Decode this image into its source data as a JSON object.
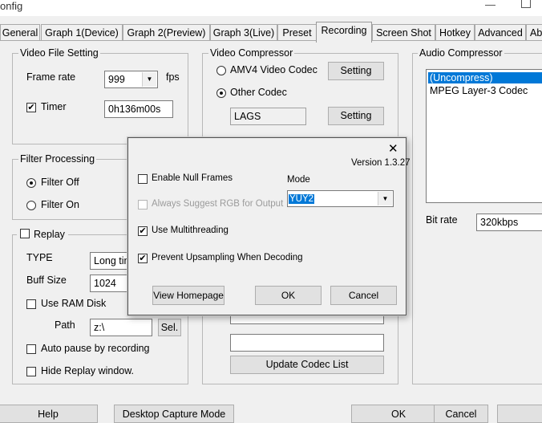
{
  "window": {
    "title": "onfig"
  },
  "tabs": [
    {
      "label": "General"
    },
    {
      "label": "Graph 1(Device)"
    },
    {
      "label": "Graph 2(Preview)"
    },
    {
      "label": "Graph 3(Live)"
    },
    {
      "label": "Preset"
    },
    {
      "label": "Recording"
    },
    {
      "label": "Screen Shot"
    },
    {
      "label": "Hotkey"
    },
    {
      "label": "Advanced"
    },
    {
      "label": "Ab"
    }
  ],
  "video_file": {
    "legend": "Video File Setting",
    "frame_rate_label": "Frame rate",
    "frame_rate_value": "999",
    "fps_label": "fps",
    "timer_label": "Timer",
    "timer_checked": true,
    "timer_value": "0h136m00s"
  },
  "filter": {
    "legend": "Filter Processing",
    "off_label": "Filter Off",
    "on_label": "Filter On",
    "selected": "off"
  },
  "replay": {
    "legend": "Replay",
    "checked": false,
    "type_label": "TYPE",
    "type_value": "Long tim",
    "buff_label": "Buff Size",
    "buff_value": "1024",
    "ram_label": "Use RAM Disk",
    "path_label": "Path",
    "path_value": "z:\\",
    "sel_label": "Sel.",
    "auto_pause_label": "Auto pause by recording",
    "hide_label": "Hide Replay window."
  },
  "video_compressor": {
    "legend": "Video Compressor",
    "amv4_label": "AMV4 Video Codec",
    "other_label": "Other Codec",
    "setting_label": "Setting",
    "codec_value": "LAGS",
    "update_label": "Update Codec List"
  },
  "audio_compressor": {
    "legend": "Audio Compressor",
    "items": [
      "(Uncompress)",
      "MPEG Layer-3 Codec"
    ],
    "selected_color": "#0078d7",
    "bitrate_label": "Bit rate",
    "bitrate_value": "320kbps"
  },
  "dialog": {
    "close_glyph": "✕",
    "version": "Version 1.3.27",
    "null_frames_label": "Enable Null Frames",
    "null_frames_checked": false,
    "rgb_label": "Always Suggest RGB for Output",
    "multithread_label": "Use Multithreading",
    "multithread_checked": true,
    "upsampling_label": "Prevent Upsampling When Decoding",
    "upsampling_checked": true,
    "mode_label": "Mode",
    "mode_value": "YUY2",
    "homepage_label": "View Homepage",
    "ok_label": "OK",
    "cancel_label": "Cancel"
  },
  "bottom": {
    "help_label": "Help",
    "desktop_label": "Desktop Capture Mode",
    "ok_label": "OK",
    "cancel_label": "Cancel"
  }
}
